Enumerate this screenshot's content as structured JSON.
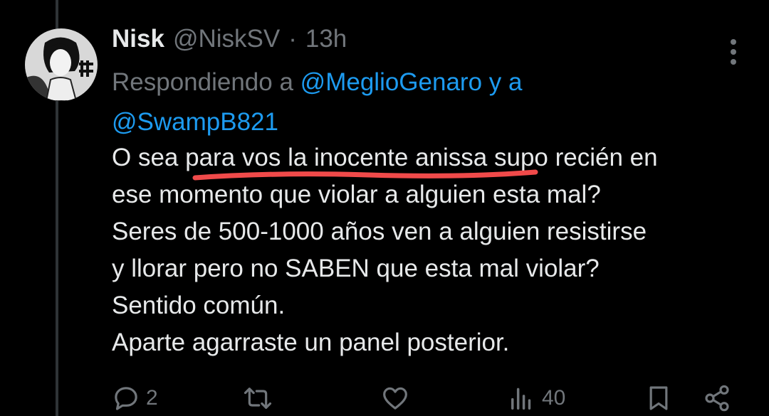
{
  "header": {
    "name": "Nisk",
    "handle": "@NiskSV",
    "separator": "·",
    "time": "13h"
  },
  "reply": {
    "prefix": "Respondiendo a",
    "mention1": "@MeglioGenaro",
    "conjunction": "y a",
    "mention2": "@SwampB821"
  },
  "tweet": {
    "lines": [
      "O sea para vos la inocente anissa supo recién en",
      "ese momento que violar a alguien esta mal?",
      "Seres de 500-1000 años ven a alguien resistirse",
      "y llorar pero no SABEN que esta mal violar?",
      "Sentido común.",
      "Aparte agarraste un panel posterior."
    ]
  },
  "actions": {
    "replies": "2",
    "retweets": "",
    "likes": "",
    "views": "40"
  },
  "colors": {
    "background": "#000000",
    "text": "#e7e9ea",
    "secondary": "#71767b",
    "link": "#1d9bf0",
    "annotation": "#f04a4a"
  },
  "icons": [
    "more-icon",
    "reply-icon",
    "retweet-icon",
    "like-icon",
    "views-icon",
    "bookmark-icon",
    "share-icon"
  ]
}
